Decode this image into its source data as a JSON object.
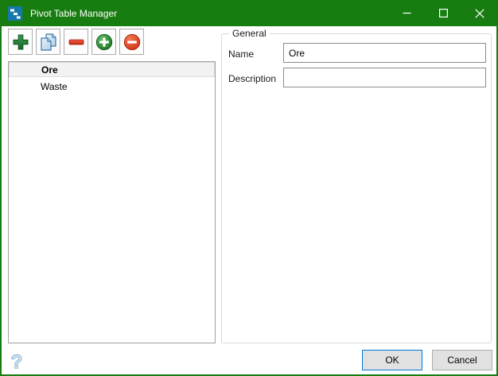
{
  "window": {
    "title": "Pivot Table Manager",
    "app_icon": "steps-chart-icon"
  },
  "titlebar": {
    "minimize_icon": "minimize-icon",
    "maximize_icon": "maximize-icon",
    "close_icon": "close-icon"
  },
  "toolbar": {
    "buttons": [
      {
        "icon": "add-plus-icon"
      },
      {
        "icon": "copy-documents-icon"
      },
      {
        "icon": "remove-minus-icon"
      },
      {
        "icon": "add-circle-icon"
      },
      {
        "icon": "remove-circle-icon"
      }
    ]
  },
  "pivot_list": {
    "items": [
      {
        "label": "Ore",
        "selected": true
      },
      {
        "label": "Waste",
        "selected": false
      }
    ]
  },
  "general_group": {
    "title": "General",
    "name_label": "Name",
    "name_value": "Ore",
    "description_label": "Description",
    "description_value": ""
  },
  "footer": {
    "help_icon": "help-question-icon",
    "ok_label": "OK",
    "cancel_label": "Cancel"
  },
  "colors": {
    "titlebar_green": "#187d11",
    "ok_border_blue": "#0078d7",
    "selection_bg": "#f2f2f2"
  }
}
